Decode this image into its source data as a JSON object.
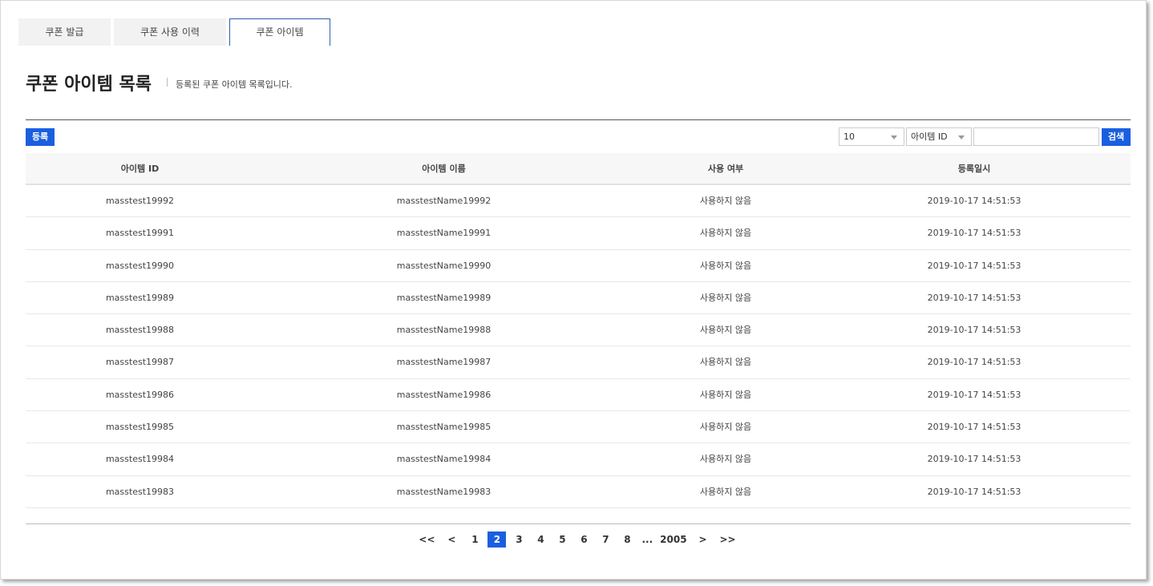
{
  "tabs": [
    {
      "label": "쿠폰 발급"
    },
    {
      "label": "쿠폰 사용 이력"
    },
    {
      "label": "쿠폰 아이템"
    }
  ],
  "header": {
    "title": "쿠폰 아이템 목록",
    "description": "등록된 쿠폰 아이템 목록입니다."
  },
  "toolbar": {
    "register_label": "등록",
    "page_size": "10",
    "search_field": "아이템 ID",
    "search_value": "",
    "search_label": "검색"
  },
  "table": {
    "columns": [
      "아이템 ID",
      "아이템 이름",
      "사용 여부",
      "등록일시"
    ],
    "rows": [
      [
        "masstest19992",
        "masstestName19992",
        "사용하지 않음",
        "2019-10-17 14:51:53"
      ],
      [
        "masstest19991",
        "masstestName19991",
        "사용하지 않음",
        "2019-10-17 14:51:53"
      ],
      [
        "masstest19990",
        "masstestName19990",
        "사용하지 않음",
        "2019-10-17 14:51:53"
      ],
      [
        "masstest19989",
        "masstestName19989",
        "사용하지 않음",
        "2019-10-17 14:51:53"
      ],
      [
        "masstest19988",
        "masstestName19988",
        "사용하지 않음",
        "2019-10-17 14:51:53"
      ],
      [
        "masstest19987",
        "masstestName19987",
        "사용하지 않음",
        "2019-10-17 14:51:53"
      ],
      [
        "masstest19986",
        "masstestName19986",
        "사용하지 않음",
        "2019-10-17 14:51:53"
      ],
      [
        "masstest19985",
        "masstestName19985",
        "사용하지 않음",
        "2019-10-17 14:51:53"
      ],
      [
        "masstest19984",
        "masstestName19984",
        "사용하지 않음",
        "2019-10-17 14:51:53"
      ],
      [
        "masstest19983",
        "masstestName19983",
        "사용하지 않음",
        "2019-10-17 14:51:53"
      ]
    ]
  },
  "pagination": {
    "first": "<<",
    "prev": "<",
    "pages": [
      "1",
      "2",
      "3",
      "4",
      "5",
      "6",
      "7",
      "8"
    ],
    "current": "2",
    "ellipsis": "...",
    "last_page": "2005",
    "next": ">",
    "last": ">>"
  },
  "colors": {
    "accent": "#1a5fe0",
    "tab_border": "#2b5fb3"
  }
}
